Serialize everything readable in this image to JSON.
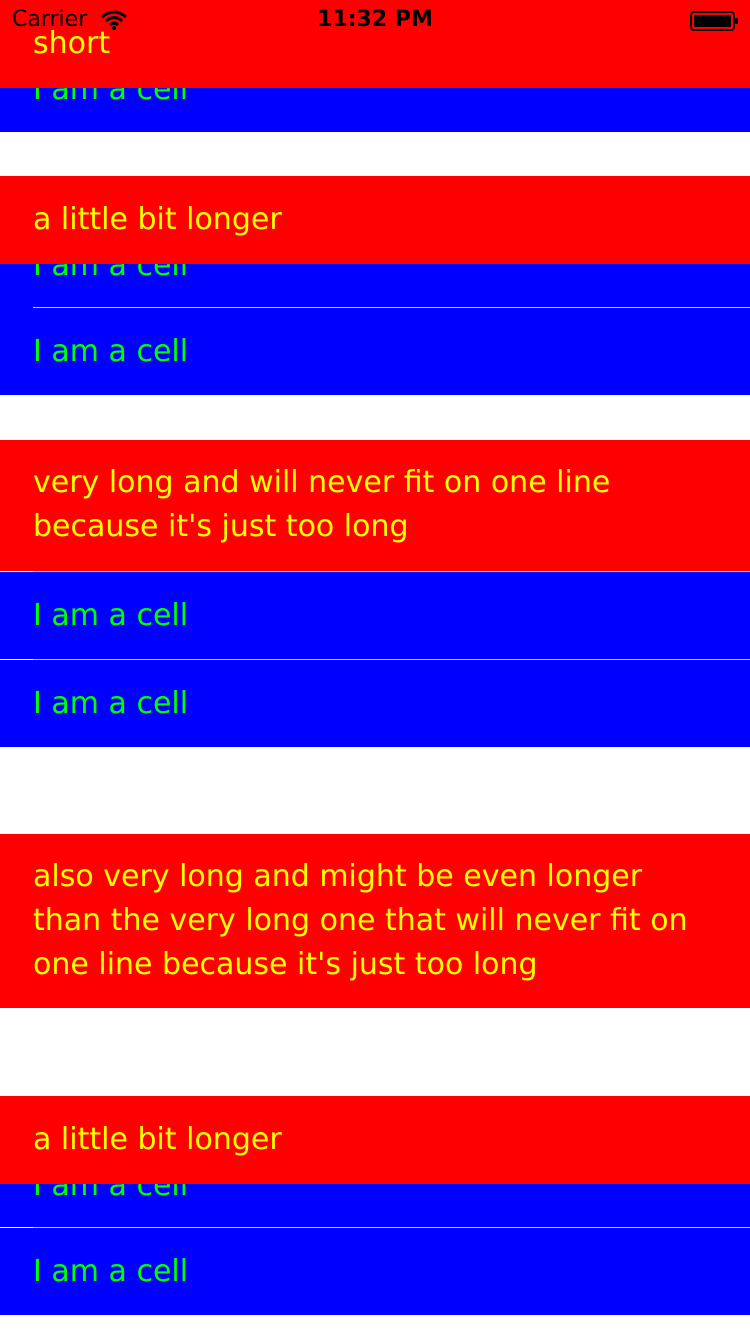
{
  "status_bar": {
    "carrier": "Carrier",
    "time": "11:32 PM",
    "icons": [
      "wifi-icon",
      "battery-icon"
    ]
  },
  "colors": {
    "header_bg": "#ff0000",
    "header_text": "#ffff00",
    "cell_bg": "#0000ff",
    "cell_text": "#00ff00",
    "background": "#ffffff"
  },
  "sections": [
    {
      "header": "short",
      "cells": [
        "I am a cell"
      ]
    },
    {
      "header": "a little bit longer",
      "cells": [
        "I am a cell",
        "I am a cell"
      ]
    },
    {
      "header": "very long and will never fit on one line because it's just too long",
      "cells": [
        "I am a cell",
        "I am a cell"
      ]
    },
    {
      "header": "also very long and might be even longer than the very long one that will never fit on one line because it's just too long",
      "cells": []
    },
    {
      "header": "a little bit longer",
      "cells": [
        "I am a cell",
        "I am a cell"
      ]
    }
  ]
}
